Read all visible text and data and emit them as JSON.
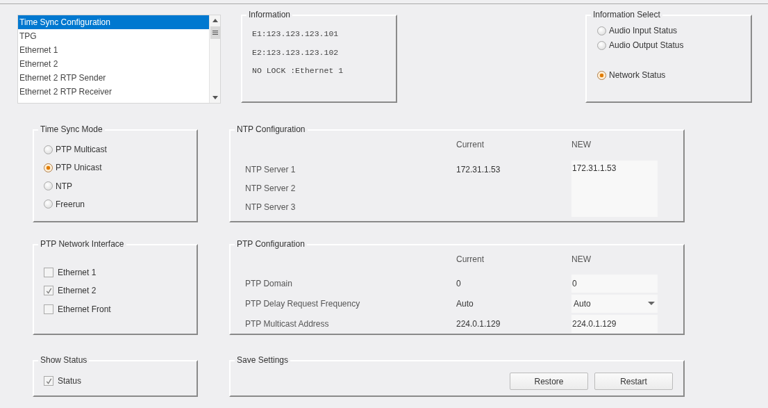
{
  "list": {
    "items": [
      {
        "label": "Time Sync Configuration",
        "selected": true
      },
      {
        "label": "TPG",
        "selected": false
      },
      {
        "label": "Ethernet 1",
        "selected": false
      },
      {
        "label": "Ethernet 2",
        "selected": false
      },
      {
        "label": "Ethernet 2 RTP Sender",
        "selected": false
      },
      {
        "label": "Ethernet 2 RTP Receiver",
        "selected": false
      }
    ]
  },
  "information": {
    "title": "Information",
    "lines": [
      "E1:123.123.123.101",
      "E2:123.123.123.102",
      "NO LOCK :Ethernet 1"
    ]
  },
  "information_select": {
    "title": "Information Select",
    "options": [
      {
        "label": "Audio Input Status",
        "selected": false
      },
      {
        "label": "Audio Output Status",
        "selected": false
      },
      {
        "label": "Network Status",
        "selected": true
      }
    ]
  },
  "time_sync_mode": {
    "title": "Time Sync Mode",
    "options": [
      {
        "label": "PTP Multicast",
        "selected": false
      },
      {
        "label": "PTP Unicast",
        "selected": true
      },
      {
        "label": "NTP",
        "selected": false
      },
      {
        "label": "Freerun",
        "selected": false
      }
    ]
  },
  "ntp_configuration": {
    "title": "NTP Configuration",
    "columns": [
      "Current",
      "NEW"
    ],
    "rows": [
      {
        "label": "NTP Server 1",
        "current": "172.31.1.53"
      },
      {
        "label": "NTP Server 2"
      },
      {
        "label": "NTP Server 3"
      }
    ],
    "new_servers": "172.31.1.53"
  },
  "ptp_network_interface": {
    "title": "PTP Network Interface",
    "options": [
      {
        "label": "Ethernet 1",
        "checked": false
      },
      {
        "label": "Ethernet 2",
        "checked": true
      },
      {
        "label": "Ethernet Front",
        "checked": false
      }
    ]
  },
  "ptp_configuration": {
    "title": "PTP Configuration",
    "columns": [
      "Current",
      "NEW"
    ],
    "rows": [
      {
        "label": "PTP Domain",
        "current": "0",
        "new": "0",
        "kind": "text"
      },
      {
        "label": "PTP Delay Request Frequency",
        "current": "Auto",
        "new": "Auto",
        "kind": "dropdown"
      },
      {
        "label": "PTP Multicast Address",
        "current": "224.0.1.129",
        "new": "224.0.1.129",
        "kind": "text"
      }
    ]
  },
  "show_status": {
    "title": "Show Status",
    "options": [
      {
        "label": "Status",
        "checked": true
      }
    ]
  },
  "save_settings": {
    "title": "Save Settings",
    "buttons": [
      "Restore",
      "Restart"
    ]
  }
}
